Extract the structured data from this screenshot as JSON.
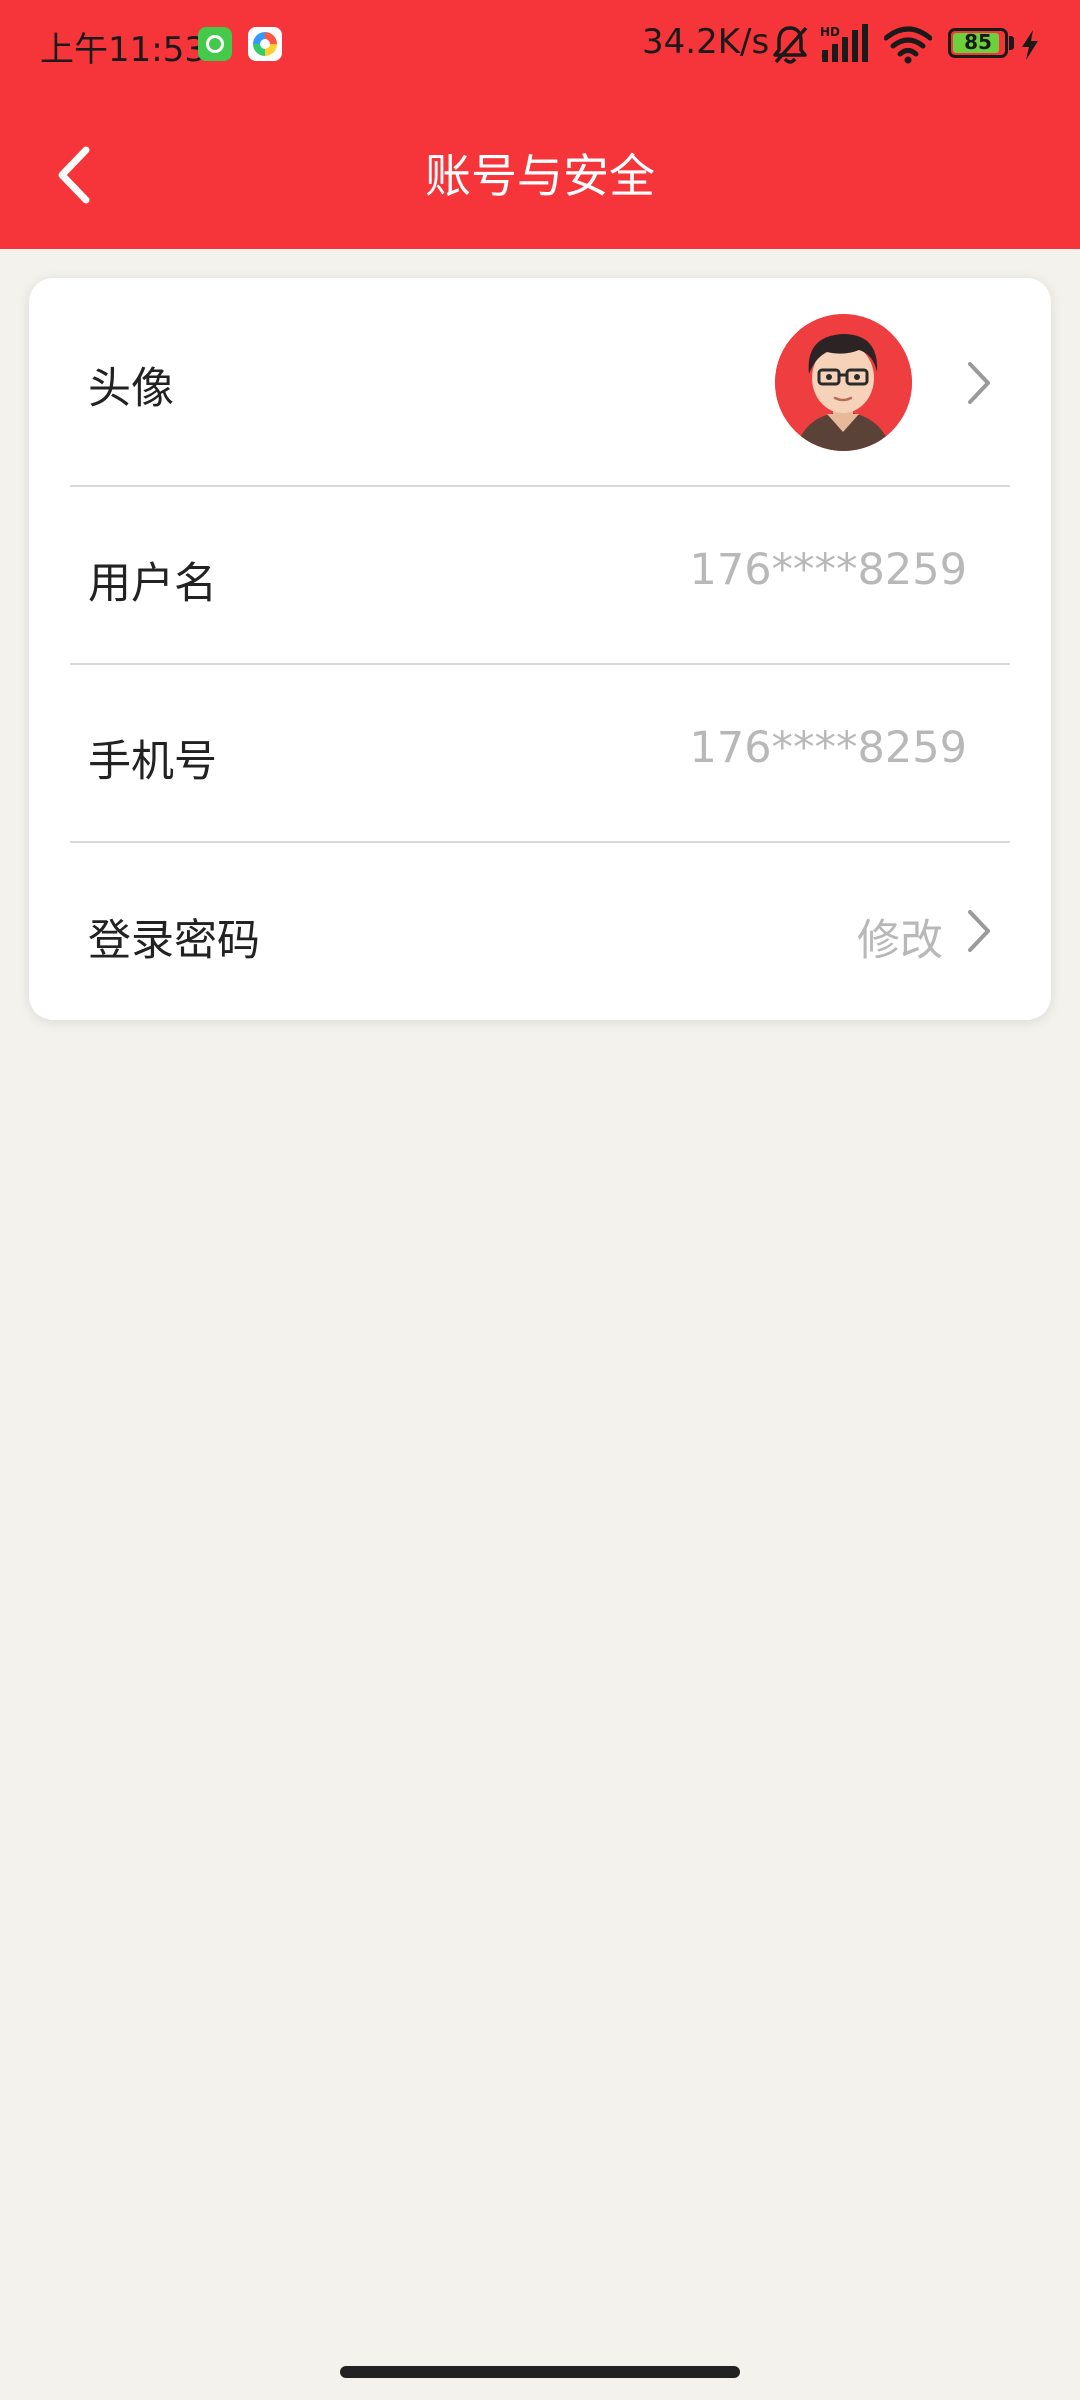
{
  "status_bar": {
    "time": "上午11:53",
    "network_speed": "34.2K/s",
    "battery": "85",
    "icons": [
      "app-badge-icon",
      "browser-icon",
      "mute-bell-icon",
      "hd-signal-icon",
      "wifi-icon",
      "battery-icon",
      "charging-icon"
    ]
  },
  "header": {
    "title": "账号与安全",
    "back_icon": "chevron-left-icon",
    "color": "#f5353a"
  },
  "settings": {
    "avatar": {
      "label": "头像"
    },
    "username": {
      "label": "用户名",
      "value": "176****8259"
    },
    "phone": {
      "label": "手机号",
      "value": "176****8259"
    },
    "password": {
      "label": "登录密码",
      "action": "修改"
    }
  },
  "colors": {
    "background": "#f3f2ed",
    "value_text": "#b8b8b8",
    "avatar_bg": "#ef3e40"
  }
}
